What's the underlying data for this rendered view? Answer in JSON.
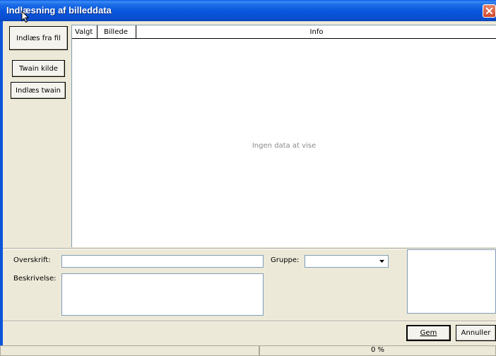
{
  "window": {
    "title": "Indlæsning af billeddata"
  },
  "left_buttons": {
    "load_file": "Indlæs fra fil",
    "twain_source": "Twain kilde",
    "load_twain": "Indlæs twain"
  },
  "grid": {
    "columns": [
      "Valgt",
      "Billede",
      "Info"
    ],
    "empty_text": "Ingen data at vise"
  },
  "form": {
    "heading_label": "Overskrift:",
    "description_label": "Beskrivelse:",
    "group_label": "Gruppe:",
    "heading_value": "",
    "description_value": "",
    "group_value": ""
  },
  "actions": {
    "save": "Gem",
    "cancel": "Annuller"
  },
  "status": {
    "progress_text": "0 %",
    "progress_value": 0
  }
}
